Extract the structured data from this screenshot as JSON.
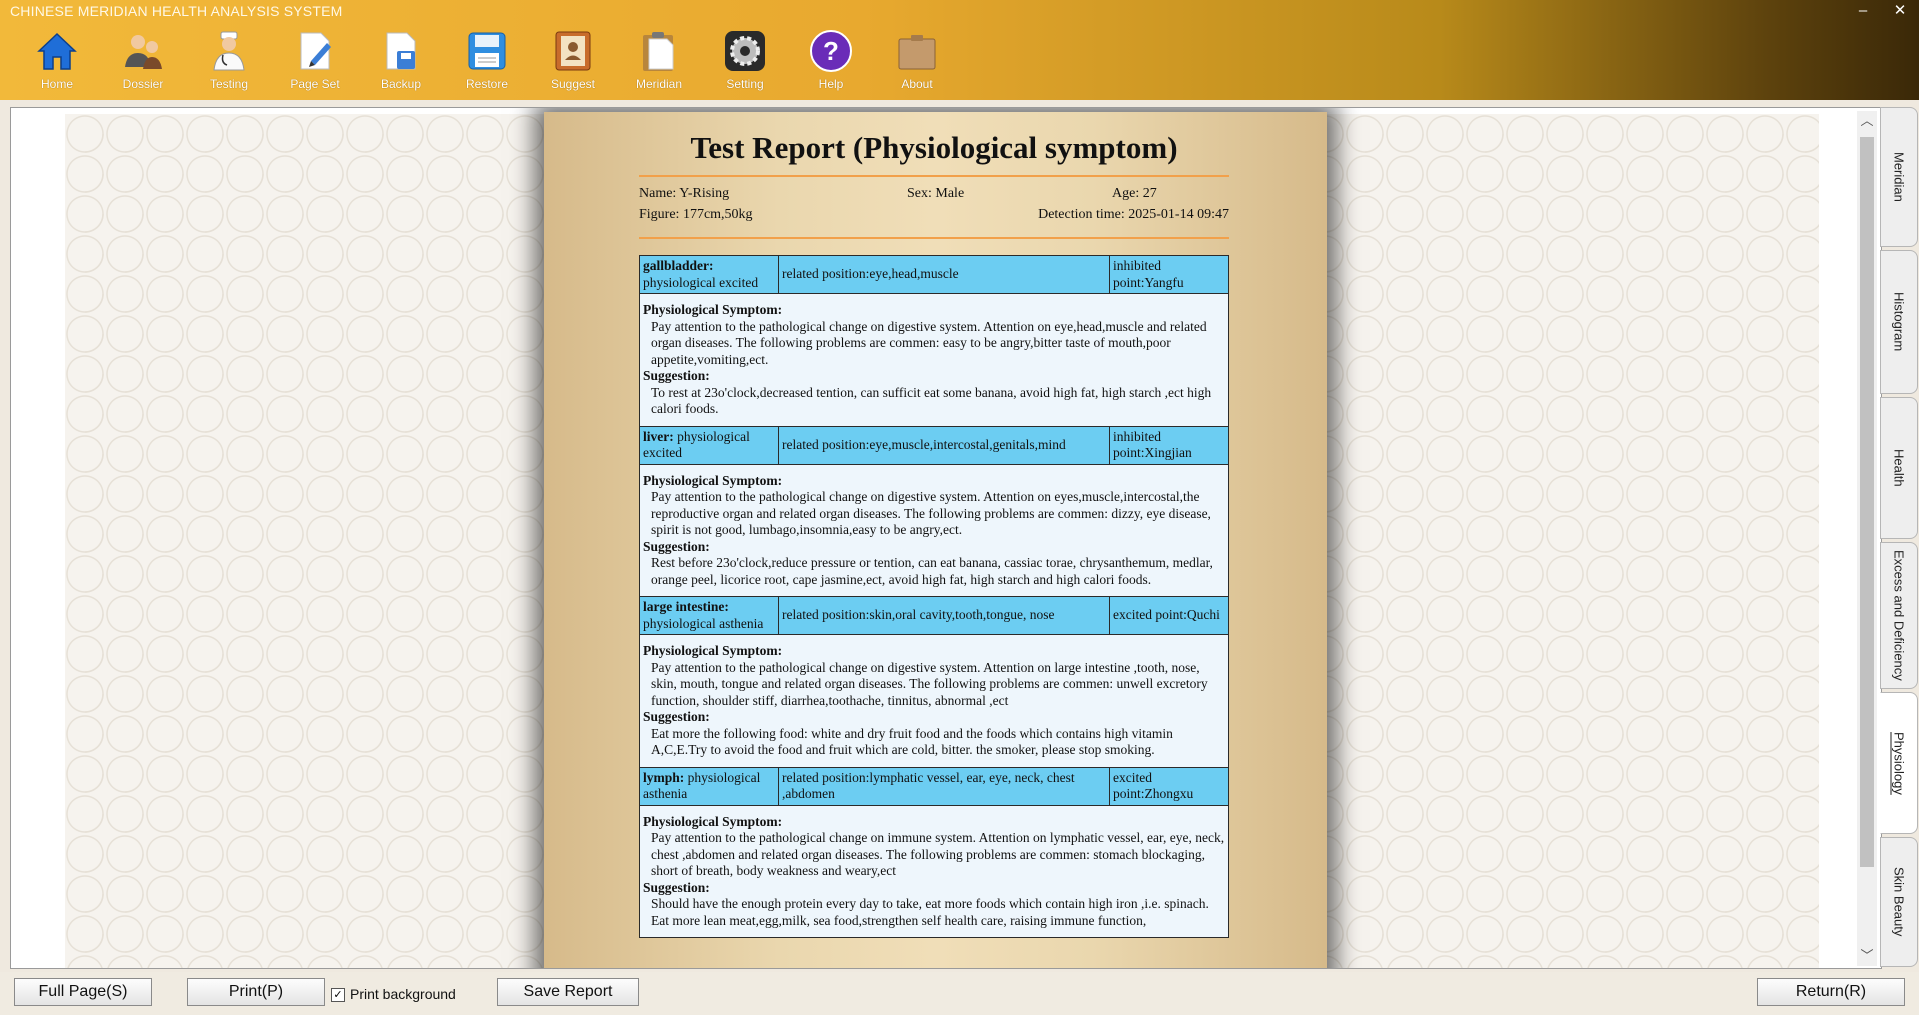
{
  "app": {
    "title": "CHINESE MERIDIAN HEALTH ANALYSIS SYSTEM"
  },
  "window": {
    "minimize": "–",
    "close": "✕"
  },
  "toolbar": [
    {
      "label": "Home",
      "icon": "home-icon"
    },
    {
      "label": "Dossier",
      "icon": "users-icon"
    },
    {
      "label": "Testing",
      "icon": "doctor-icon"
    },
    {
      "label": "Page Set",
      "icon": "page-edit-icon"
    },
    {
      "label": "Backup",
      "icon": "save-document-icon"
    },
    {
      "label": "Restore",
      "icon": "restore-disk-icon"
    },
    {
      "label": "Suggest",
      "icon": "address-book-icon"
    },
    {
      "label": "Meridian",
      "icon": "clipboard-icon"
    },
    {
      "label": "Setting",
      "icon": "gear-icon"
    },
    {
      "label": "Help",
      "icon": "help-icon"
    },
    {
      "label": "About",
      "icon": "folder-icon"
    }
  ],
  "report": {
    "title": "Test Report (Physiological symptom)",
    "name": "Name: Y-Rising",
    "sex": "Sex: Male",
    "age": "Age: 27",
    "figure": "Figure: 177cm,50kg",
    "detection": "Detection time: 2025-01-14 09:47",
    "symptom_label": "Physiological Symptom:",
    "suggestion_label": "Suggestion:",
    "items": [
      {
        "organ": "gallbladder:",
        "state": "physiological excited",
        "position": "related position:eye,head,muscle",
        "point": "inhibited point:Yangfu",
        "symptom": "Pay attention to the pathological change on digestive system. Attention on eye,head,muscle and related organ diseases. The following problems are commen: easy to be angry,bitter taste of mouth,poor appetite,vomiting,ect.",
        "suggestion": "To rest at 23o'clock,decreased tention, can sufficit eat some banana, avoid high fat, high starch ,ect high calori foods."
      },
      {
        "organ": "liver:",
        "state": "physiological excited",
        "position": "related position:eye,muscle,intercostal,genitals,mind",
        "point": "inhibited point:Xingjian",
        "symptom": "Pay attention to the pathological change on digestive system. Attention on eyes,muscle,intercostal,the reproductive organ and related organ diseases. The following problems are commen: dizzy, eye disease, spirit is not good, lumbago,insomnia,easy to be angry,ect.",
        "suggestion": "Rest before 23o'clock,reduce pressure or tention, can eat banana, cassiac torae, chrysanthemum, medlar, orange peel, licorice root, cape jasmine,ect, avoid high fat, high starch and high calori foods."
      },
      {
        "organ": "large intestine:",
        "state": "physiological asthenia",
        "position": "related position:skin,oral cavity,tooth,tongue, nose",
        "point": "excited point:Quchi",
        "symptom": "Pay attention to the pathological change on digestive system. Attention on large intestine ,tooth, nose, skin, mouth, tongue and related organ diseases. The following problems are commen: unwell excretory function, shoulder stiff, diarrhea,toothache, tinnitus, abnormal ,ect",
        "suggestion": "Eat more the following food: white and dry fruit food and the foods which contains high vitamin A,C,E.Try to avoid the food and fruit which are cold, bitter. the smoker, please stop smoking."
      },
      {
        "organ": "lymph:",
        "state": "physiological asthenia",
        "position": "related position:lymphatic vessel, ear, eye, neck, chest ,abdomen",
        "point": "excited point:Zhongxu",
        "symptom": "Pay attention to the pathological change on immune system. Attention on lymphatic vessel, ear, eye, neck, chest ,abdomen and related organ diseases. The following problems are commen: stomach blockaging, short of breath, body weakness and weary,ect",
        "suggestion": "Should have the enough protein every day to take, eat more foods which contain high iron ,i.e. spinach. Eat more lean meat,egg,milk, sea food,strengthen self health care, raising immune function,"
      }
    ]
  },
  "side_tabs": [
    {
      "label": "Meridian"
    },
    {
      "label": "Histogram"
    },
    {
      "label": "Health"
    },
    {
      "label": "Excess and Deficiency"
    },
    {
      "label": "Physiology",
      "active": true
    },
    {
      "label": "Skin Beauty"
    }
  ],
  "bottom": {
    "full_page": "Full Page(S)",
    "print": "Print(P)",
    "print_background": "Print background",
    "print_background_checked": true,
    "save_report": "Save Report",
    "return": "Return(R)"
  },
  "colors": {
    "header_cell": "#6ccdf2",
    "body_cell": "#eef6fc",
    "accent_line": "#f2a04a"
  }
}
